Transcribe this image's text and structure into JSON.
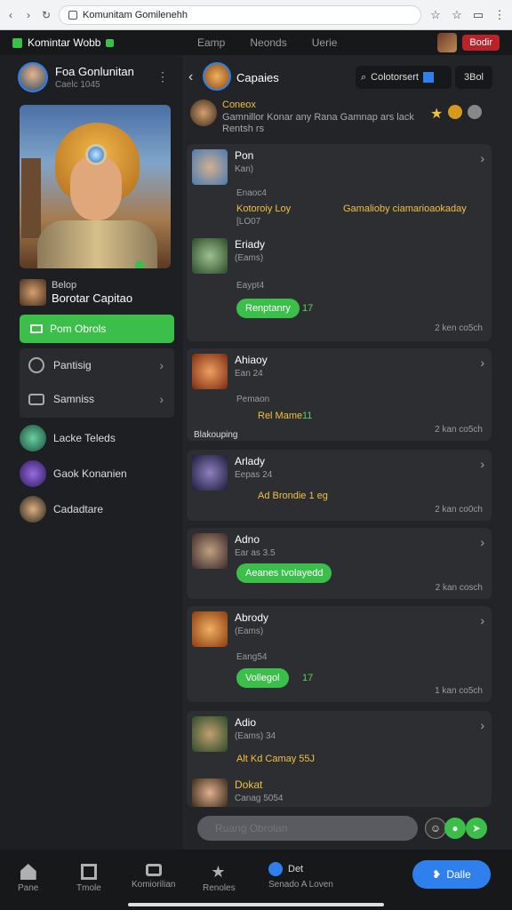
{
  "browser": {
    "url": "Komunitam Gomilenehh"
  },
  "topbar": {
    "brand": "Komintar Wobb",
    "nav": [
      "Eamp",
      "Neonds",
      "Uerie"
    ],
    "badge": "Bodir"
  },
  "sidebar": {
    "profile_name": "Foa Gonlunitan",
    "profile_sub": "Caelc 1045",
    "captain_label": "Belop",
    "captain_name": "Borotar Capitao",
    "primary_btn": "Pom Obrols",
    "menu": [
      {
        "label": "Pantisig"
      },
      {
        "label": "Samniss"
      }
    ],
    "list": [
      {
        "label": "Lacke Teleds"
      },
      {
        "label": "Gaok Konanien"
      },
      {
        "label": "Cadadtare"
      }
    ]
  },
  "chat": {
    "title": "Capaies",
    "search_label": "Colotorsert",
    "btn_label": "3Bol",
    "sub_name": "Coneox",
    "sub_desc": "Gamnillor Konar any Rana Gamnap ars lack Rentsh rs",
    "cards": [
      {
        "name": "Pon",
        "sub": "Kan)",
        "label1": "Enaoc4",
        "msg": "Kotoroiy Loy",
        "msg2": "Gamalioby ciamarioaokaday",
        "label2": "[LO07",
        "name2": "Eriady",
        "sub2": "(Eams)",
        "label3": "Eaypt4",
        "pill": "Renptanry",
        "count": "17",
        "time": "2 ken co5ch"
      },
      {
        "name": "Ahiaoy",
        "sub": "Ean 24",
        "label1": "Pemaon",
        "msg": "Rel Mame",
        "count": "11",
        "footer": "Blakouping",
        "time": "2 kan co5ch"
      },
      {
        "name": "Arlady",
        "sub": "Eepas 24",
        "msg": "Ad Brondie 1 eg",
        "time": "2 kan co0ch"
      },
      {
        "name": "Adno",
        "sub": "Ear as 3.5",
        "pill": "Aeanes tvolayedd",
        "time": "2 kan cosch"
      },
      {
        "name": "Abrody",
        "sub": "(Eams)",
        "label1": "Eang54",
        "pill": "Vollegol",
        "count": "17",
        "time": "1 kan co5ch"
      },
      {
        "name": "Adio",
        "sub": "(Eams) 34",
        "msg": "Alt Kd Camay 55J",
        "name2": "Dokat",
        "sub2": "Canag 5054"
      }
    ],
    "input_placeholder": "Ruang Obrolan"
  },
  "bottomnav": {
    "items": [
      {
        "label": "Pane"
      },
      {
        "label": "Tmole"
      },
      {
        "label": "Komiorilian"
      },
      {
        "label": "Renoles"
      }
    ],
    "profile_name": "Det",
    "profile_sub": "Senado A Loven",
    "cta": "Dalle"
  }
}
